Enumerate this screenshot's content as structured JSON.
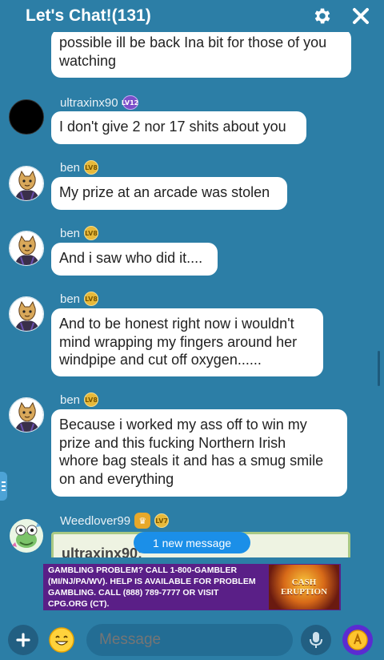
{
  "header": {
    "title": "Let's Chat!(131)"
  },
  "messages": [
    {
      "text_lines": [
        "possible ill be back Ina bit for those of you",
        "watching"
      ]
    },
    {
      "name": "ultraxinx90",
      "level": "LV12",
      "text": "I don't give 2 nor 17 shits about you"
    },
    {
      "name": "ben",
      "level": "LV8",
      "text": "My prize at an arcade was stolen"
    },
    {
      "name": "ben",
      "level": "LV8",
      "text": "And i saw who did it...."
    },
    {
      "name": "ben",
      "level": "LV8",
      "text_lines": [
        "And to be honest right now i wouldn't",
        "mind wrapping my fingers around her",
        "windpipe and cut off oxygen......"
      ]
    },
    {
      "name": "ben",
      "level": "LV8",
      "text_lines": [
        "Because i worked my ass off to win my",
        "prize and this fucking Northern Irish",
        "whore bag steals it and has a smug smile",
        "on and everything"
      ]
    },
    {
      "name": "Weedlover99",
      "level": "LV7",
      "partial_text": "ultraxinx90:"
    }
  ],
  "new_message_pill": "1 new message",
  "ad": {
    "lines": [
      "GAMBLING PROBLEM? CALL 1-800-GAMBLER",
      "(MI/NJ/PA/WV). HELP IS AVAILABLE FOR PROBLEM",
      "GAMBLING. CALL (888) 789-7777 OR VISIT",
      "CPG.ORG (CT)."
    ],
    "logo_line1": "CASH",
    "logo_line2": "ERUPTION"
  },
  "composer": {
    "placeholder": "Message"
  },
  "colors": {
    "background": "#2c7ea6",
    "bubble": "#ffffff",
    "pill": "#1b8fe8",
    "ad_bg": "#5a1f87"
  }
}
